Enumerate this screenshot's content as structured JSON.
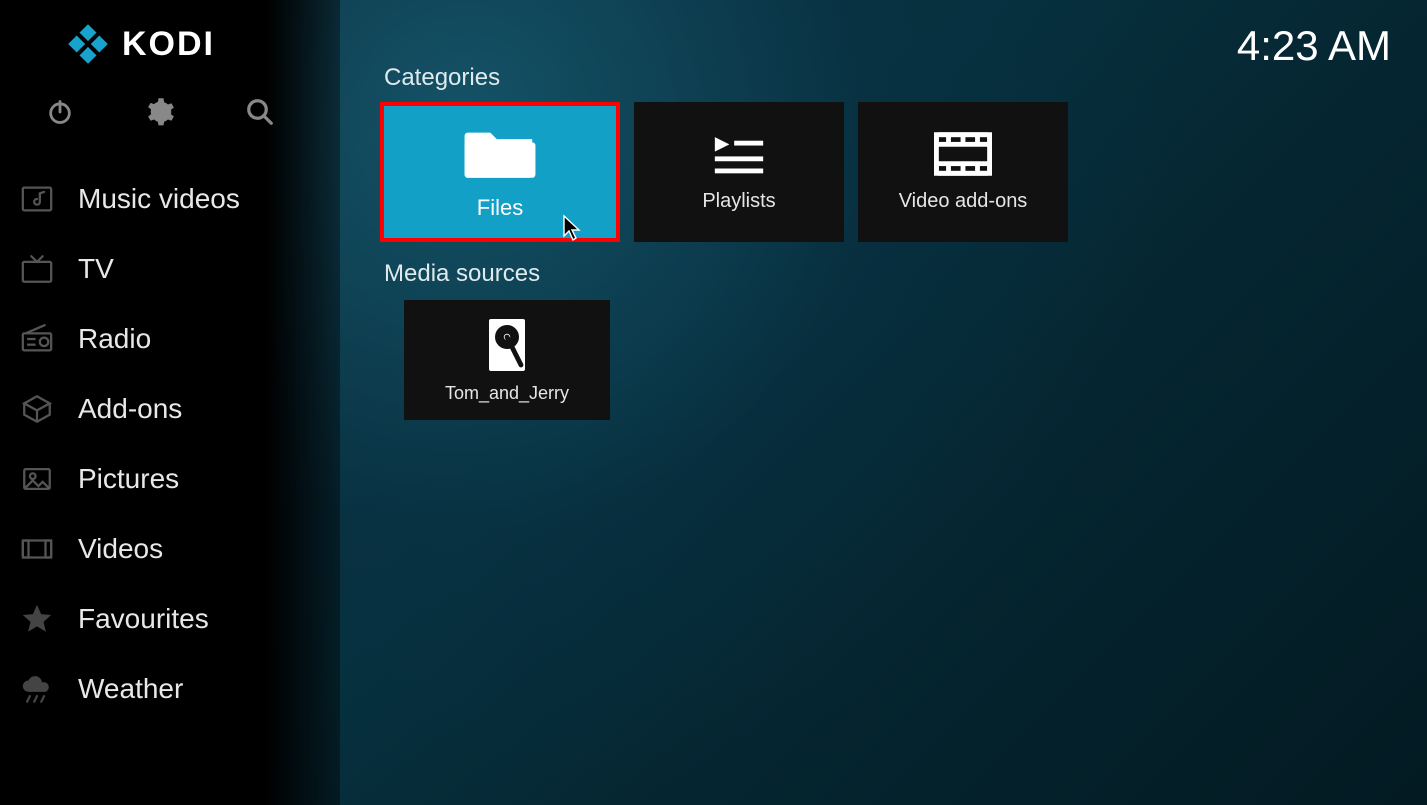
{
  "app": {
    "name": "KODI"
  },
  "clock": "4:23 AM",
  "sidebar": {
    "items": [
      {
        "label": "Music videos",
        "icon": "music-video"
      },
      {
        "label": "TV",
        "icon": "tv"
      },
      {
        "label": "Radio",
        "icon": "radio"
      },
      {
        "label": "Add-ons",
        "icon": "addons"
      },
      {
        "label": "Pictures",
        "icon": "pictures"
      },
      {
        "label": "Videos",
        "icon": "videos"
      },
      {
        "label": "Favourites",
        "icon": "star"
      },
      {
        "label": "Weather",
        "icon": "weather"
      }
    ]
  },
  "main": {
    "categories_title": "Categories",
    "categories": [
      {
        "label": "Files",
        "icon": "folder",
        "selected": true
      },
      {
        "label": "Playlists",
        "icon": "playlist",
        "selected": false
      },
      {
        "label": "Video add-ons",
        "icon": "film",
        "selected": false
      }
    ],
    "media_sources_title": "Media sources",
    "media_sources": [
      {
        "label": "Tom_and_Jerry",
        "icon": "hdd"
      }
    ]
  }
}
